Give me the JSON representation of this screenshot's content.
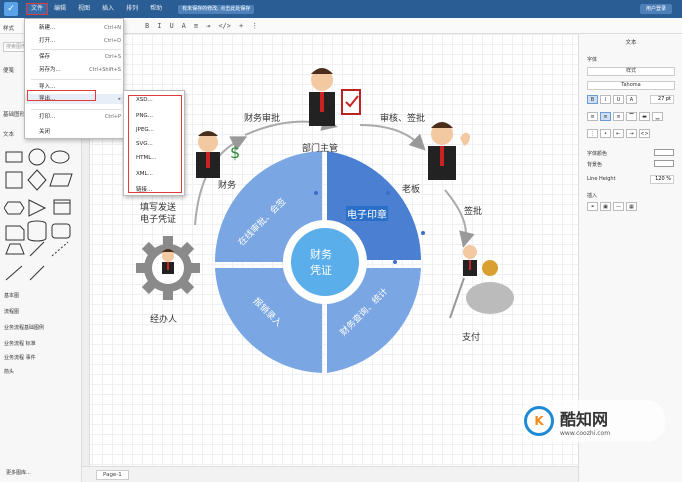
{
  "topbar": {
    "logo": "✓",
    "menu": [
      "文件",
      "编辑",
      "视图",
      "插入",
      "排列",
      "帮助"
    ],
    "notice": "有未保存的修改, 点击此处保存",
    "user": "用户登录"
  },
  "toolbar": {
    "buttons": [
      "B",
      "I",
      "U",
      "A",
      "≡",
      "⇥",
      "</>",
      "+",
      "⋮"
    ]
  },
  "left_panel": {
    "search_placeholder": "搜索图形",
    "section_style": "样式",
    "section_scratch": "便笺",
    "section_basic": "基础图形",
    "text_label": "文本",
    "categories": [
      "基本图",
      "流程图",
      "业务流程基础图例",
      "业务流程 标准",
      "业务流程 事件",
      "箭头"
    ],
    "more_shapes": "更多图库..."
  },
  "file_menu": {
    "items": [
      {
        "label": "新建...",
        "shortcut": "Ctrl+N"
      },
      {
        "label": "打开...",
        "shortcut": "Ctrl+O"
      },
      {
        "label": "保存",
        "shortcut": "Ctrl+S"
      },
      {
        "label": "另存为...",
        "shortcut": "Ctrl+Shift+S"
      },
      {
        "label": "导入...",
        "shortcut": ""
      },
      {
        "label": "导出...",
        "shortcut": ""
      },
      {
        "label": "打印...",
        "shortcut": "Ctrl+P"
      },
      {
        "label": "关闭",
        "shortcut": ""
      }
    ]
  },
  "export_submenu": {
    "items": [
      "XSD...",
      "PNG...",
      "JPEG...",
      "SVG...",
      "HTML...",
      "XML...",
      "链接..."
    ]
  },
  "diagram": {
    "labels": {
      "finance_approval": "财务审批",
      "dept_manager": "部门主管",
      "review_sign": "审核、签批",
      "finance": "财务",
      "boss": "老板",
      "fill_send_1": "填写发送",
      "fill_send_2": "电子凭证",
      "sign_approve": "签批",
      "handler": "经办人",
      "payment": "支付",
      "center_1": "财务",
      "center_2": "凭证",
      "seg_online": "在线审批、会签",
      "seg_stamp": "电子印章",
      "seg_entry": "报销录入",
      "seg_query": "财务查询、统计"
    }
  },
  "bottom": {
    "page_tab": "Page-1"
  },
  "right_panel": {
    "title": "文本",
    "font_label": "字体",
    "font_style": "样式",
    "font_name": "Tahoma",
    "font_size": "27 pt",
    "font_color_label": "字体颜色",
    "bg_color_label": "背景色",
    "line_height_label": "Line Height",
    "line_height_value": "120 %",
    "insert_label": "插入"
  },
  "watermark": {
    "logo_text": "K",
    "title": "酷知网",
    "url": "www.coozhi.com"
  },
  "colors": {
    "topbar": "#2a5d93",
    "highlight_red": "#e03c3c",
    "diagram_blue": "#6f9ee0",
    "diagram_dark_blue": "#4a7fd1",
    "center_blue": "#5aaeea"
  }
}
